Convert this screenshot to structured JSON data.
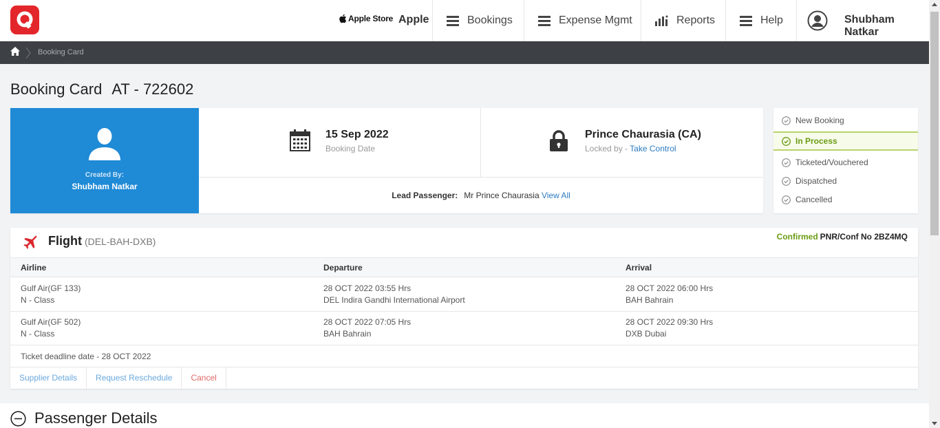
{
  "nav": {
    "apple_store_logo_text": "Apple Store",
    "apple_label": "Apple",
    "items": [
      {
        "label": "Bookings",
        "icon": "menu-icon"
      },
      {
        "label": "Expense Mgmt",
        "icon": "menu-icon"
      },
      {
        "label": "Reports",
        "icon": "bar-chart-icon"
      },
      {
        "label": "Help",
        "icon": "menu-icon"
      }
    ],
    "user_name": "Shubham Natkar"
  },
  "breadcrumb": {
    "current": "Booking Card"
  },
  "page": {
    "title": "Booking Card",
    "booking_id": "AT - 722602"
  },
  "summary": {
    "created_by_label": "Created By:",
    "created_by_name": "Shubham Natkar",
    "booking_date": "15 Sep 2022",
    "booking_date_label": "Booking Date",
    "locked_name": "Prince Chaurasia (CA)",
    "locked_by_label": "Locked by -",
    "take_control": "Take Control",
    "lead_label": "Lead Passenger:",
    "lead_name": "Mr Prince Chaurasia",
    "view_all": "View All"
  },
  "status": {
    "items": [
      "New Booking",
      "In Process",
      "Ticketed/Vouchered",
      "Dispatched",
      "Cancelled"
    ],
    "active": "In Process"
  },
  "flight": {
    "title": "Flight",
    "route": "(DEL-BAH-DXB)",
    "status": "Confirmed",
    "pnr": "PNR/Conf No 2BZ4MQ",
    "columns": [
      "Airline",
      "Departure",
      "Arrival"
    ],
    "rows": [
      {
        "airline": "Gulf Air(GF 133)",
        "class": "N - Class",
        "dep_time": "28 OCT 2022 03:55 Hrs",
        "dep_place": "DEL Indira Gandhi International Airport",
        "arr_time": "28 OCT 2022 06:00 Hrs",
        "arr_place": "BAH Bahrain"
      },
      {
        "airline": "Gulf Air(GF 502)",
        "class": "N - Class",
        "dep_time": "28 OCT 2022 07:05 Hrs",
        "dep_place": "BAH Bahrain",
        "arr_time": "28 OCT 2022 09:30 Hrs",
        "arr_place": "DXB Dubai"
      }
    ],
    "deadline": "Ticket deadline date - 28 OCT 2022",
    "actions": [
      "Supplier Details",
      "Request Reschedule",
      "Cancel"
    ]
  },
  "passenger": {
    "title": "Passenger Details"
  },
  "colors": {
    "brand_red": "#e3262b",
    "created_blue": "#1f8ad6",
    "confirmed_green": "#6a9c12",
    "link_blue": "#2a7ac0",
    "breadcrumb_bg": "#3d4145"
  }
}
